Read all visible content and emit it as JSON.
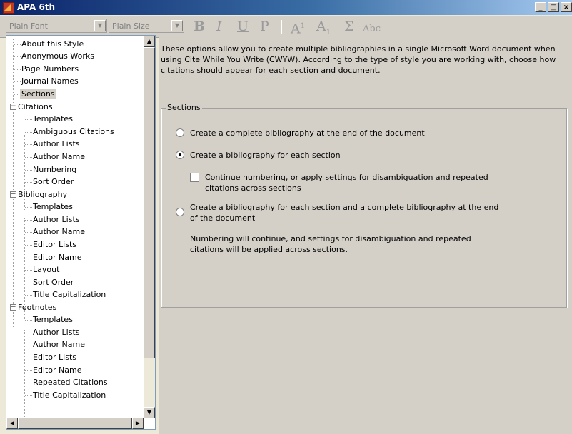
{
  "window": {
    "title": "APA 6th",
    "controls": [
      "minimize",
      "maximize",
      "close"
    ]
  },
  "toolbar": {
    "font_select": "Plain Font",
    "size_select": "Plain Size",
    "bold": "B",
    "italic": "I",
    "underline": "U",
    "plain": "P",
    "superscript": "A",
    "superscript_mark": "1",
    "subscript": "A",
    "subscript_mark": "1",
    "symbol": "Σ",
    "smallcaps": "Abc"
  },
  "tree": {
    "items": [
      {
        "label": "About this Style"
      },
      {
        "label": "Anonymous Works"
      },
      {
        "label": "Page Numbers"
      },
      {
        "label": "Journal Names"
      },
      {
        "label": "Sections"
      },
      {
        "label": "Citations"
      },
      {
        "label": "Templates"
      },
      {
        "label": "Ambiguous Citations"
      },
      {
        "label": "Author Lists"
      },
      {
        "label": "Author Name"
      },
      {
        "label": "Numbering"
      },
      {
        "label": "Sort Order"
      },
      {
        "label": "Bibliography"
      },
      {
        "label": "Templates"
      },
      {
        "label": "Author Lists"
      },
      {
        "label": "Author Name"
      },
      {
        "label": "Editor Lists"
      },
      {
        "label": "Editor Name"
      },
      {
        "label": "Layout"
      },
      {
        "label": "Sort Order"
      },
      {
        "label": "Title Capitalization"
      },
      {
        "label": "Footnotes"
      },
      {
        "label": "Templates"
      },
      {
        "label": "Author Lists"
      },
      {
        "label": "Author Name"
      },
      {
        "label": "Editor Lists"
      },
      {
        "label": "Editor Name"
      },
      {
        "label": "Repeated Citations"
      },
      {
        "label": "Title Capitalization"
      }
    ],
    "selected": "Sections"
  },
  "content": {
    "intro": "These options allow you to create multiple bibliographies in a single Microsoft Word document when using Cite While You Write (CWYW). According to the type of style you are working with, choose how citations should appear for each section and document.",
    "group_title": "Sections",
    "option1": "Create a complete bibliography at the end of the document",
    "option2": "Create a bibliography for each section",
    "checkbox": "Continue numbering, or apply settings for disambiguation and repeated citations across sections",
    "option3": "Create a bibliography for each section and a complete bibliography at the end of the document",
    "note": "Numbering will continue, and settings for disambiguation and repeated citations will be applied across sections.",
    "selected_option": 2,
    "checkbox_checked": false
  }
}
